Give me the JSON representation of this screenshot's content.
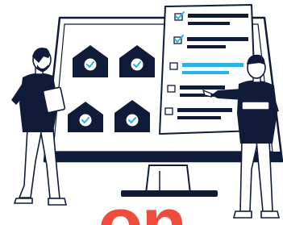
{
  "illustration": {
    "theme": "online voting / checklist review",
    "colors": {
      "ink": "#0f1b38",
      "accent": "#29b3e4",
      "highlight": "#ef4c3d",
      "paper": "#ffffff",
      "skin": "#ffffff"
    },
    "ballots": [
      {
        "icon": "check-circle-icon",
        "checked": true
      },
      {
        "icon": "check-circle-icon",
        "checked": true
      },
      {
        "icon": "check-circle-icon",
        "checked": true
      },
      {
        "icon": "check-circle-icon",
        "checked": true
      }
    ],
    "checklist": [
      {
        "checked": true,
        "highlighted": false
      },
      {
        "checked": true,
        "highlighted": false
      },
      {
        "checked": false,
        "highlighted": true
      },
      {
        "checked": false,
        "highlighted": false
      },
      {
        "checked": false,
        "highlighted": false
      }
    ]
  },
  "banner": {
    "text": "on",
    "color": "#ef4c3d"
  }
}
